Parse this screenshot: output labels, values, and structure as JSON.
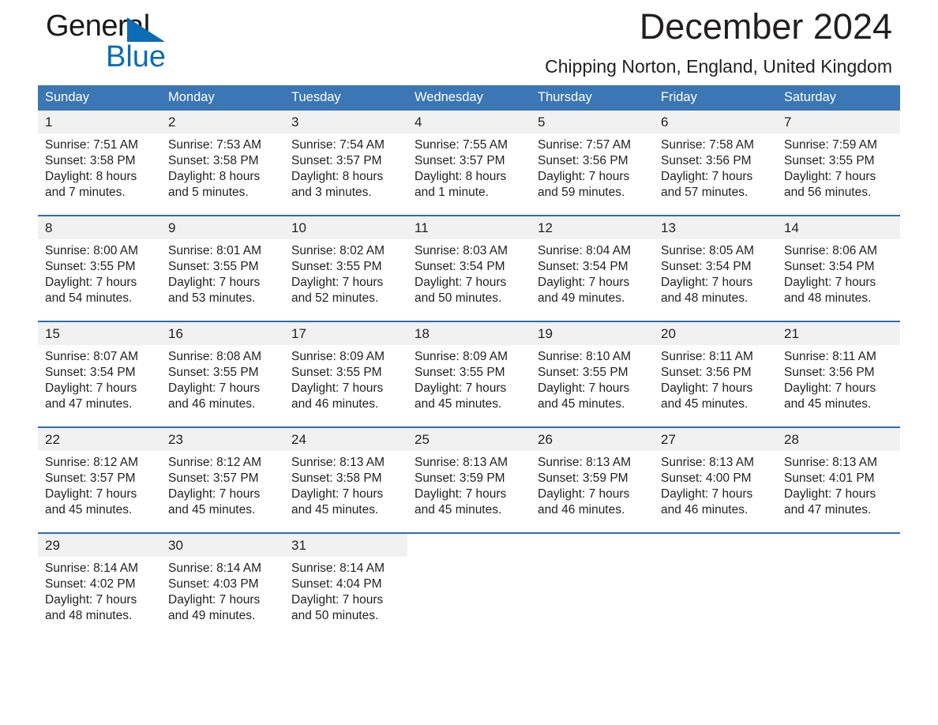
{
  "brand": {
    "word_general": "General",
    "word_blue": "Blue",
    "triangle_icon": "triangle-icon",
    "accent_color": "#0c6cb5"
  },
  "header": {
    "month_title": "December 2024",
    "location": "Chipping Norton, England, United Kingdom"
  },
  "theme": {
    "header_blue": "#3b76b5",
    "rule_blue": "#2f6cad",
    "daynum_bg": "#f1f1f1",
    "text": "#231f20"
  },
  "calendar": {
    "weekdays": [
      "Sunday",
      "Monday",
      "Tuesday",
      "Wednesday",
      "Thursday",
      "Friday",
      "Saturday"
    ],
    "weeks": [
      [
        {
          "day": "1",
          "sunrise": "Sunrise: 7:51 AM",
          "sunset": "Sunset: 3:58 PM",
          "daylight": "Daylight: 8 hours and 7 minutes."
        },
        {
          "day": "2",
          "sunrise": "Sunrise: 7:53 AM",
          "sunset": "Sunset: 3:58 PM",
          "daylight": "Daylight: 8 hours and 5 minutes."
        },
        {
          "day": "3",
          "sunrise": "Sunrise: 7:54 AM",
          "sunset": "Sunset: 3:57 PM",
          "daylight": "Daylight: 8 hours and 3 minutes."
        },
        {
          "day": "4",
          "sunrise": "Sunrise: 7:55 AM",
          "sunset": "Sunset: 3:57 PM",
          "daylight": "Daylight: 8 hours and 1 minute."
        },
        {
          "day": "5",
          "sunrise": "Sunrise: 7:57 AM",
          "sunset": "Sunset: 3:56 PM",
          "daylight": "Daylight: 7 hours and 59 minutes."
        },
        {
          "day": "6",
          "sunrise": "Sunrise: 7:58 AM",
          "sunset": "Sunset: 3:56 PM",
          "daylight": "Daylight: 7 hours and 57 minutes."
        },
        {
          "day": "7",
          "sunrise": "Sunrise: 7:59 AM",
          "sunset": "Sunset: 3:55 PM",
          "daylight": "Daylight: 7 hours and 56 minutes."
        }
      ],
      [
        {
          "day": "8",
          "sunrise": "Sunrise: 8:00 AM",
          "sunset": "Sunset: 3:55 PM",
          "daylight": "Daylight: 7 hours and 54 minutes."
        },
        {
          "day": "9",
          "sunrise": "Sunrise: 8:01 AM",
          "sunset": "Sunset: 3:55 PM",
          "daylight": "Daylight: 7 hours and 53 minutes."
        },
        {
          "day": "10",
          "sunrise": "Sunrise: 8:02 AM",
          "sunset": "Sunset: 3:55 PM",
          "daylight": "Daylight: 7 hours and 52 minutes."
        },
        {
          "day": "11",
          "sunrise": "Sunrise: 8:03 AM",
          "sunset": "Sunset: 3:54 PM",
          "daylight": "Daylight: 7 hours and 50 minutes."
        },
        {
          "day": "12",
          "sunrise": "Sunrise: 8:04 AM",
          "sunset": "Sunset: 3:54 PM",
          "daylight": "Daylight: 7 hours and 49 minutes."
        },
        {
          "day": "13",
          "sunrise": "Sunrise: 8:05 AM",
          "sunset": "Sunset: 3:54 PM",
          "daylight": "Daylight: 7 hours and 48 minutes."
        },
        {
          "day": "14",
          "sunrise": "Sunrise: 8:06 AM",
          "sunset": "Sunset: 3:54 PM",
          "daylight": "Daylight: 7 hours and 48 minutes."
        }
      ],
      [
        {
          "day": "15",
          "sunrise": "Sunrise: 8:07 AM",
          "sunset": "Sunset: 3:54 PM",
          "daylight": "Daylight: 7 hours and 47 minutes."
        },
        {
          "day": "16",
          "sunrise": "Sunrise: 8:08 AM",
          "sunset": "Sunset: 3:55 PM",
          "daylight": "Daylight: 7 hours and 46 minutes."
        },
        {
          "day": "17",
          "sunrise": "Sunrise: 8:09 AM",
          "sunset": "Sunset: 3:55 PM",
          "daylight": "Daylight: 7 hours and 46 minutes."
        },
        {
          "day": "18",
          "sunrise": "Sunrise: 8:09 AM",
          "sunset": "Sunset: 3:55 PM",
          "daylight": "Daylight: 7 hours and 45 minutes."
        },
        {
          "day": "19",
          "sunrise": "Sunrise: 8:10 AM",
          "sunset": "Sunset: 3:55 PM",
          "daylight": "Daylight: 7 hours and 45 minutes."
        },
        {
          "day": "20",
          "sunrise": "Sunrise: 8:11 AM",
          "sunset": "Sunset: 3:56 PM",
          "daylight": "Daylight: 7 hours and 45 minutes."
        },
        {
          "day": "21",
          "sunrise": "Sunrise: 8:11 AM",
          "sunset": "Sunset: 3:56 PM",
          "daylight": "Daylight: 7 hours and 45 minutes."
        }
      ],
      [
        {
          "day": "22",
          "sunrise": "Sunrise: 8:12 AM",
          "sunset": "Sunset: 3:57 PM",
          "daylight": "Daylight: 7 hours and 45 minutes."
        },
        {
          "day": "23",
          "sunrise": "Sunrise: 8:12 AM",
          "sunset": "Sunset: 3:57 PM",
          "daylight": "Daylight: 7 hours and 45 minutes."
        },
        {
          "day": "24",
          "sunrise": "Sunrise: 8:13 AM",
          "sunset": "Sunset: 3:58 PM",
          "daylight": "Daylight: 7 hours and 45 minutes."
        },
        {
          "day": "25",
          "sunrise": "Sunrise: 8:13 AM",
          "sunset": "Sunset: 3:59 PM",
          "daylight": "Daylight: 7 hours and 45 minutes."
        },
        {
          "day": "26",
          "sunrise": "Sunrise: 8:13 AM",
          "sunset": "Sunset: 3:59 PM",
          "daylight": "Daylight: 7 hours and 46 minutes."
        },
        {
          "day": "27",
          "sunrise": "Sunrise: 8:13 AM",
          "sunset": "Sunset: 4:00 PM",
          "daylight": "Daylight: 7 hours and 46 minutes."
        },
        {
          "day": "28",
          "sunrise": "Sunrise: 8:13 AM",
          "sunset": "Sunset: 4:01 PM",
          "daylight": "Daylight: 7 hours and 47 minutes."
        }
      ],
      [
        {
          "day": "29",
          "sunrise": "Sunrise: 8:14 AM",
          "sunset": "Sunset: 4:02 PM",
          "daylight": "Daylight: 7 hours and 48 minutes."
        },
        {
          "day": "30",
          "sunrise": "Sunrise: 8:14 AM",
          "sunset": "Sunset: 4:03 PM",
          "daylight": "Daylight: 7 hours and 49 minutes."
        },
        {
          "day": "31",
          "sunrise": "Sunrise: 8:14 AM",
          "sunset": "Sunset: 4:04 PM",
          "daylight": "Daylight: 7 hours and 50 minutes."
        },
        {
          "day": "",
          "sunrise": "",
          "sunset": "",
          "daylight": ""
        },
        {
          "day": "",
          "sunrise": "",
          "sunset": "",
          "daylight": ""
        },
        {
          "day": "",
          "sunrise": "",
          "sunset": "",
          "daylight": ""
        },
        {
          "day": "",
          "sunrise": "",
          "sunset": "",
          "daylight": ""
        }
      ]
    ]
  }
}
